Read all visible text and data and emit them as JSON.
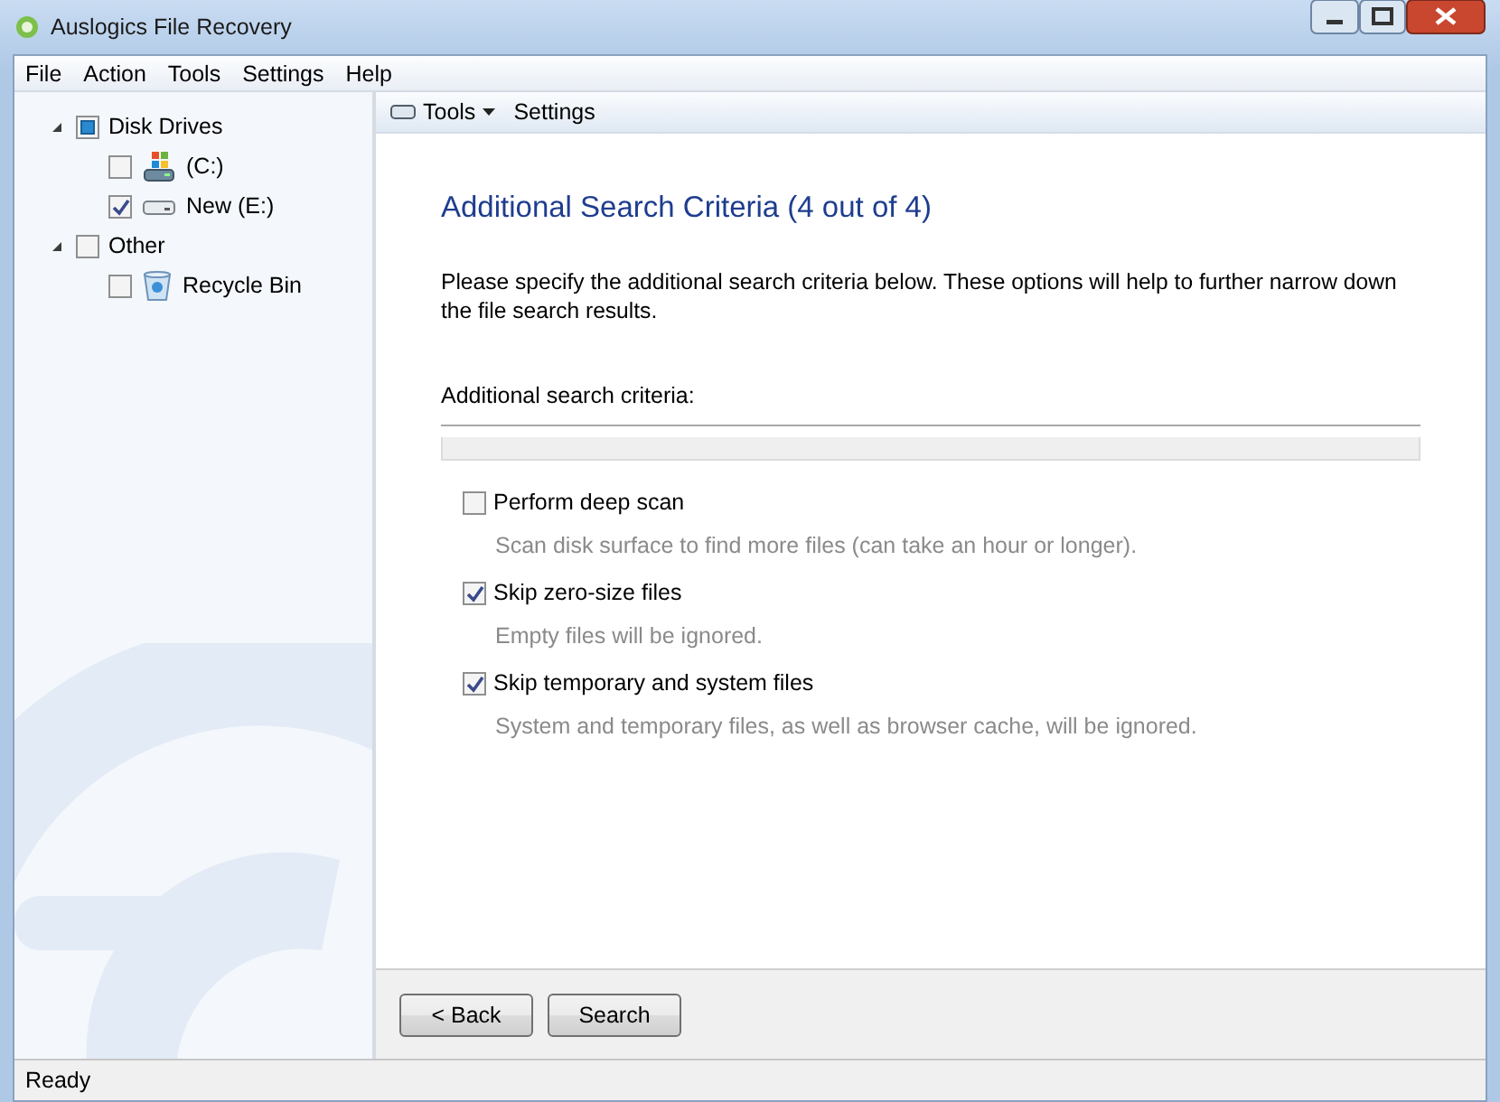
{
  "window": {
    "title": "Auslogics File Recovery"
  },
  "menu": [
    "File",
    "Action",
    "Tools",
    "Settings",
    "Help"
  ],
  "tree": [
    {
      "label": "Disk Drives",
      "checked": false,
      "partial": true,
      "expanded": true,
      "children": [
        {
          "label": "(C:)",
          "checked": false,
          "partial": false,
          "kind": "system-drive"
        },
        {
          "label": "New (E:)",
          "checked": true,
          "partial": false,
          "kind": "drive"
        }
      ]
    },
    {
      "label": "Other",
      "checked": false,
      "partial": false,
      "expanded": true,
      "children": [
        {
          "label": "Recycle Bin",
          "checked": false,
          "partial": false,
          "kind": "recycle-bin"
        }
      ]
    }
  ],
  "toolbar": [
    {
      "label": "Tools",
      "kind": "menu"
    },
    {
      "label": "Settings",
      "kind": "plain"
    }
  ],
  "page": {
    "heading": "Additional Search Criteria (4 out of 4)",
    "intro": "Please specify the additional search criteria below. These options will help to further narrow down the file search results.",
    "section_label": "Additional search criteria:",
    "options": [
      {
        "label": "Perform deep scan",
        "description": "Scan disk surface to find more files (can take an hour or longer).",
        "checked": false
      },
      {
        "label": "Skip zero-size files",
        "description": "Empty files will be ignored.",
        "checked": true
      },
      {
        "label": "Skip temporary and system files",
        "description": "System and temporary files, as well as browser cache, will be ignored.",
        "checked": true
      }
    ]
  },
  "buttons": [
    {
      "label": "< Back"
    },
    {
      "label": "Search"
    }
  ],
  "status_bar": "Ready"
}
